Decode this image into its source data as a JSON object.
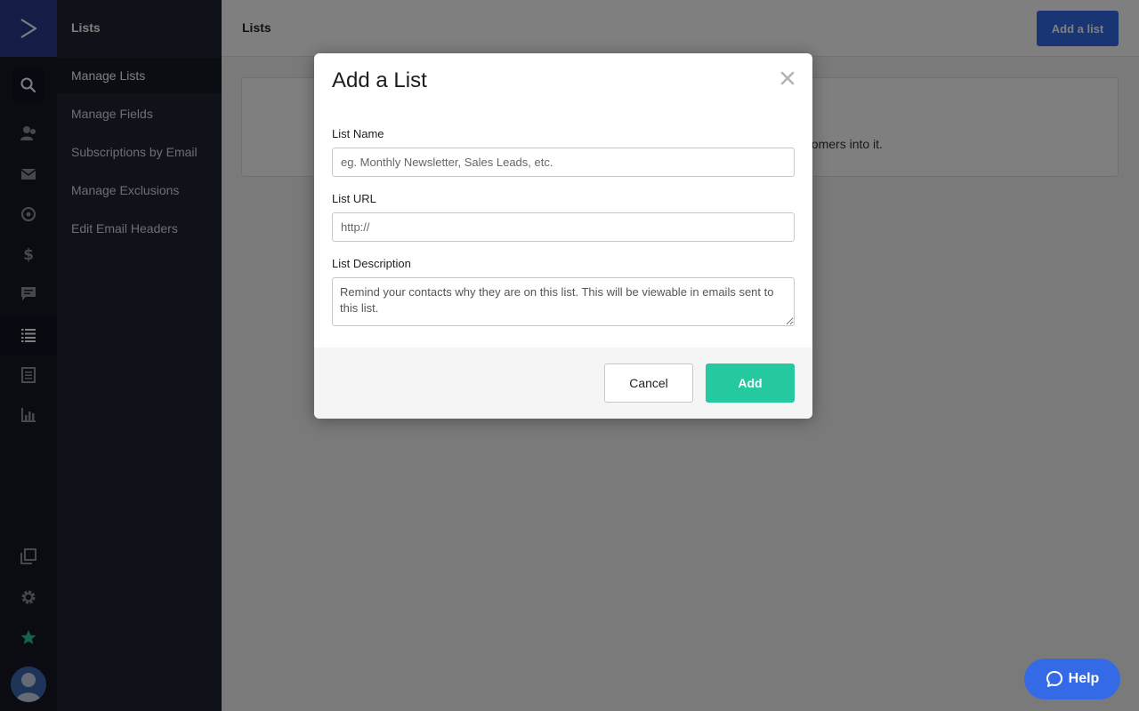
{
  "sidebar": {
    "section_title": "Lists",
    "items": [
      {
        "label": "Manage Lists",
        "active": true
      },
      {
        "label": "Manage Fields"
      },
      {
        "label": "Subscriptions by Email"
      },
      {
        "label": "Manage Exclusions"
      },
      {
        "label": "Edit Email Headers"
      }
    ]
  },
  "rail": {
    "icons": [
      "logo-icon",
      "search-icon",
      "contacts-icon",
      "email-icon",
      "automations-icon",
      "deals-icon",
      "conversations-icon",
      "lists-icon",
      "forms-icon",
      "reports-icon",
      "pages-icon",
      "settings-icon",
      "star-icon",
      "avatar"
    ]
  },
  "header": {
    "title": "Lists",
    "add_button": "Add a list"
  },
  "content": {
    "visible_text": "our customers into it."
  },
  "modal": {
    "title": "Add a List",
    "list_name_label": "List Name",
    "list_name_placeholder": "eg. Monthly Newsletter, Sales Leads, etc.",
    "list_url_label": "List URL",
    "list_url_placeholder": "http://",
    "list_description_label": "List Description",
    "list_description_placeholder": "Remind your contacts why they are on this list. This will be viewable in emails sent to this list.",
    "cancel_label": "Cancel",
    "add_label": "Add"
  },
  "help": {
    "label": "Help"
  },
  "colors": {
    "accent": "#356ae6",
    "add_button": "#25c9a0",
    "rail_bg": "#141925",
    "subnav_bg": "#1f2533"
  }
}
